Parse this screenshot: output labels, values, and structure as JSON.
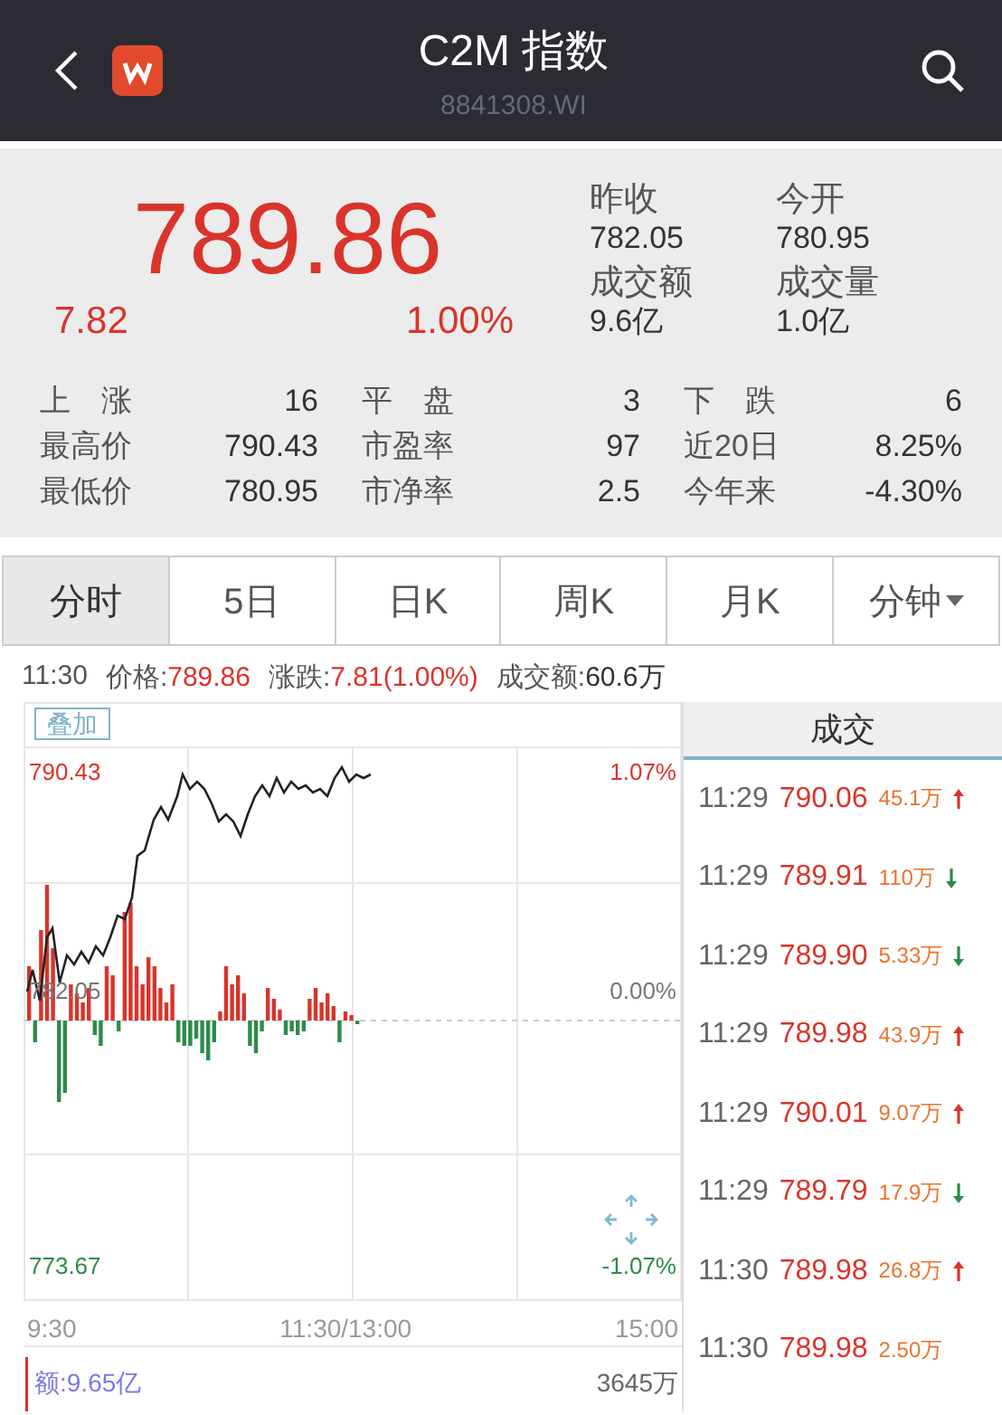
{
  "header": {
    "title": "C2M 指数",
    "code": "8841308.WI"
  },
  "quote": {
    "price": "789.86",
    "change": "7.82",
    "change_pct": "1.00%",
    "fields": [
      {
        "label": "昨收",
        "value": "782.05"
      },
      {
        "label": "今开",
        "value": "780.95"
      },
      {
        "label": "成交额",
        "value": "9.6亿"
      },
      {
        "label": "成交量",
        "value": "1.0亿"
      }
    ],
    "stats": [
      {
        "label": "上涨",
        "value": "16"
      },
      {
        "label": "平盘",
        "value": "3"
      },
      {
        "label": "下跌",
        "value": "6"
      },
      {
        "label": "最高价",
        "value": "790.43"
      },
      {
        "label": "市盈率",
        "value": "97"
      },
      {
        "label": "近20日",
        "value": "8.25%"
      },
      {
        "label": "最低价",
        "value": "780.95"
      },
      {
        "label": "市净率",
        "value": "2.5"
      },
      {
        "label": "今年来",
        "value": "-4.30%"
      }
    ]
  },
  "tabs": [
    {
      "label": "分时",
      "selected": true
    },
    {
      "label": "5日",
      "selected": false
    },
    {
      "label": "日K",
      "selected": false
    },
    {
      "label": "周K",
      "selected": false
    },
    {
      "label": "月K",
      "selected": false
    },
    {
      "label": "分钟",
      "selected": false,
      "dropdown": true
    }
  ],
  "info": {
    "time": "11:30",
    "price_label": "价格:",
    "price": "789.86",
    "change_label": "涨跌:",
    "change": "7.81(1.00%)",
    "amount_label": "成交额:",
    "amount": "60.6万"
  },
  "chart": {
    "overlay_button": "叠加",
    "high": "790.43",
    "high_pct": "1.07%",
    "prev": "782.05",
    "zero_pct": "0.00%",
    "low": "773.67",
    "low_pct": "-1.07%",
    "times": [
      "9:30",
      "11:30/13:00",
      "15:00"
    ],
    "amount": "额:9.65亿",
    "volume_max": "3645万"
  },
  "trades": {
    "title": "成交",
    "rows": [
      {
        "time": "11:29",
        "price": "790.06",
        "volume": "45.1万",
        "kind": "up"
      },
      {
        "time": "11:29",
        "price": "789.91",
        "volume": "110万",
        "kind": "down"
      },
      {
        "time": "11:29",
        "price": "789.90",
        "volume": "5.33万",
        "kind": "down"
      },
      {
        "time": "11:29",
        "price": "789.98",
        "volume": "43.9万",
        "kind": "up"
      },
      {
        "time": "11:29",
        "price": "790.01",
        "volume": "9.07万",
        "kind": "up"
      },
      {
        "time": "11:29",
        "price": "789.79",
        "volume": "17.9万",
        "kind": "down"
      },
      {
        "time": "11:30",
        "price": "789.98",
        "volume": "26.8万",
        "kind": "up"
      },
      {
        "time": "11:30",
        "price": "789.98",
        "volume": "2.50万",
        "kind": "plain"
      }
    ]
  }
}
